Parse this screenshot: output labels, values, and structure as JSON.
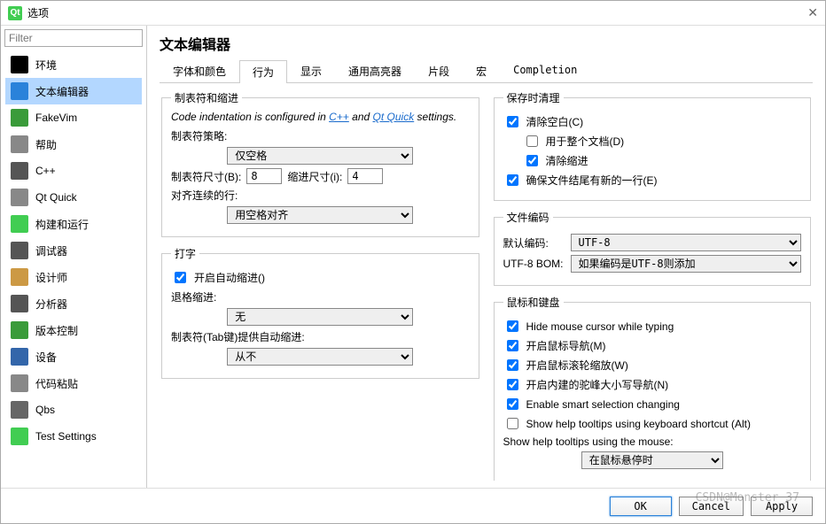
{
  "titlebar": {
    "title": "选项"
  },
  "filter": {
    "placeholder": "Filter"
  },
  "sidebar": {
    "items": [
      {
        "label": "环境",
        "selected": false,
        "iconColor": "#000"
      },
      {
        "label": "文本编辑器",
        "selected": true,
        "iconColor": "#2a82da"
      },
      {
        "label": "FakeVim",
        "selected": false,
        "iconColor": "#3a9b3a"
      },
      {
        "label": "帮助",
        "selected": false,
        "iconColor": "#888"
      },
      {
        "label": "C++",
        "selected": false,
        "iconColor": "#555"
      },
      {
        "label": "Qt Quick",
        "selected": false,
        "iconColor": "#888"
      },
      {
        "label": "构建和运行",
        "selected": false,
        "iconColor": "#41cd52"
      },
      {
        "label": "调试器",
        "selected": false,
        "iconColor": "#555"
      },
      {
        "label": "设计师",
        "selected": false,
        "iconColor": "#c94"
      },
      {
        "label": "分析器",
        "selected": false,
        "iconColor": "#555"
      },
      {
        "label": "版本控制",
        "selected": false,
        "iconColor": "#3a9b3a"
      },
      {
        "label": "设备",
        "selected": false,
        "iconColor": "#36a"
      },
      {
        "label": "代码粘贴",
        "selected": false,
        "iconColor": "#888"
      },
      {
        "label": "Qbs",
        "selected": false,
        "iconColor": "#666"
      },
      {
        "label": "Test Settings",
        "selected": false,
        "iconColor": "#41cd52"
      }
    ]
  },
  "page": {
    "title": "文本编辑器"
  },
  "tabs": [
    {
      "label": "字体和颜色",
      "active": false
    },
    {
      "label": "行为",
      "active": true
    },
    {
      "label": "显示",
      "active": false
    },
    {
      "label": "通用高亮器",
      "active": false
    },
    {
      "label": "片段",
      "active": false
    },
    {
      "label": "宏",
      "active": false
    },
    {
      "label": "Completion",
      "active": false
    }
  ],
  "group_tabs_indent": {
    "legend": "制表符和缩进",
    "hint_prefix": "Code indentation is configured in ",
    "hint_link1": "C++",
    "hint_mid": " and ",
    "hint_link2": "Qt Quick",
    "hint_suffix": " settings.",
    "tab_policy_label": "制表符策略:",
    "tab_policy_value": "仅空格",
    "tab_size_label": "制表符尺寸(B):",
    "tab_size_value": "8",
    "indent_size_label": "缩进尺寸(i):",
    "indent_size_value": "4",
    "align_label": "对齐连续的行:",
    "align_value": "用空格对齐"
  },
  "group_typing": {
    "legend": "打字",
    "auto_indent_label": "开启自动缩进()",
    "auto_indent_checked": true,
    "backspace_label": "退格缩进:",
    "backspace_value": "无",
    "tab_key_label": "制表符(Tab键)提供自动缩进:",
    "tab_key_value": "从不"
  },
  "group_cleanup": {
    "legend": "保存时清理",
    "clean_ws_label": "清除空白(C)",
    "clean_ws_checked": true,
    "whole_doc_label": "用于整个文档(D)",
    "whole_doc_checked": false,
    "clean_indent_label": "清除缩进",
    "clean_indent_checked": true,
    "newline_label": "确保文件结尾有新的一行(E)",
    "newline_checked": true
  },
  "group_encoding": {
    "legend": "文件编码",
    "default_label": "默认编码:",
    "default_value": "UTF-8",
    "bom_label": "UTF-8 BOM:",
    "bom_value": "如果编码是UTF-8则添加"
  },
  "group_mouse": {
    "legend": "鼠标和键盘",
    "hide_cursor_label": "Hide mouse cursor while typing",
    "hide_cursor_checked": true,
    "mouse_nav_label": "开启鼠标导航(M)",
    "mouse_nav_checked": true,
    "scroll_zoom_label": "开启鼠标滚轮缩放(W)",
    "scroll_zoom_checked": true,
    "camelcase_label": "开启内建的驼峰大小写导航(N)",
    "camelcase_checked": true,
    "smart_sel_label": "Enable smart selection changing",
    "smart_sel_checked": true,
    "help_alt_label": "Show help tooltips using keyboard shortcut (Alt)",
    "help_alt_checked": false,
    "help_mouse_label": "Show help tooltips using the mouse:",
    "help_mouse_value": "在鼠标悬停时"
  },
  "footer": {
    "ok": "OK",
    "cancel": "Cancel",
    "apply": "Apply"
  },
  "watermark": "CSDN@Monster_37"
}
